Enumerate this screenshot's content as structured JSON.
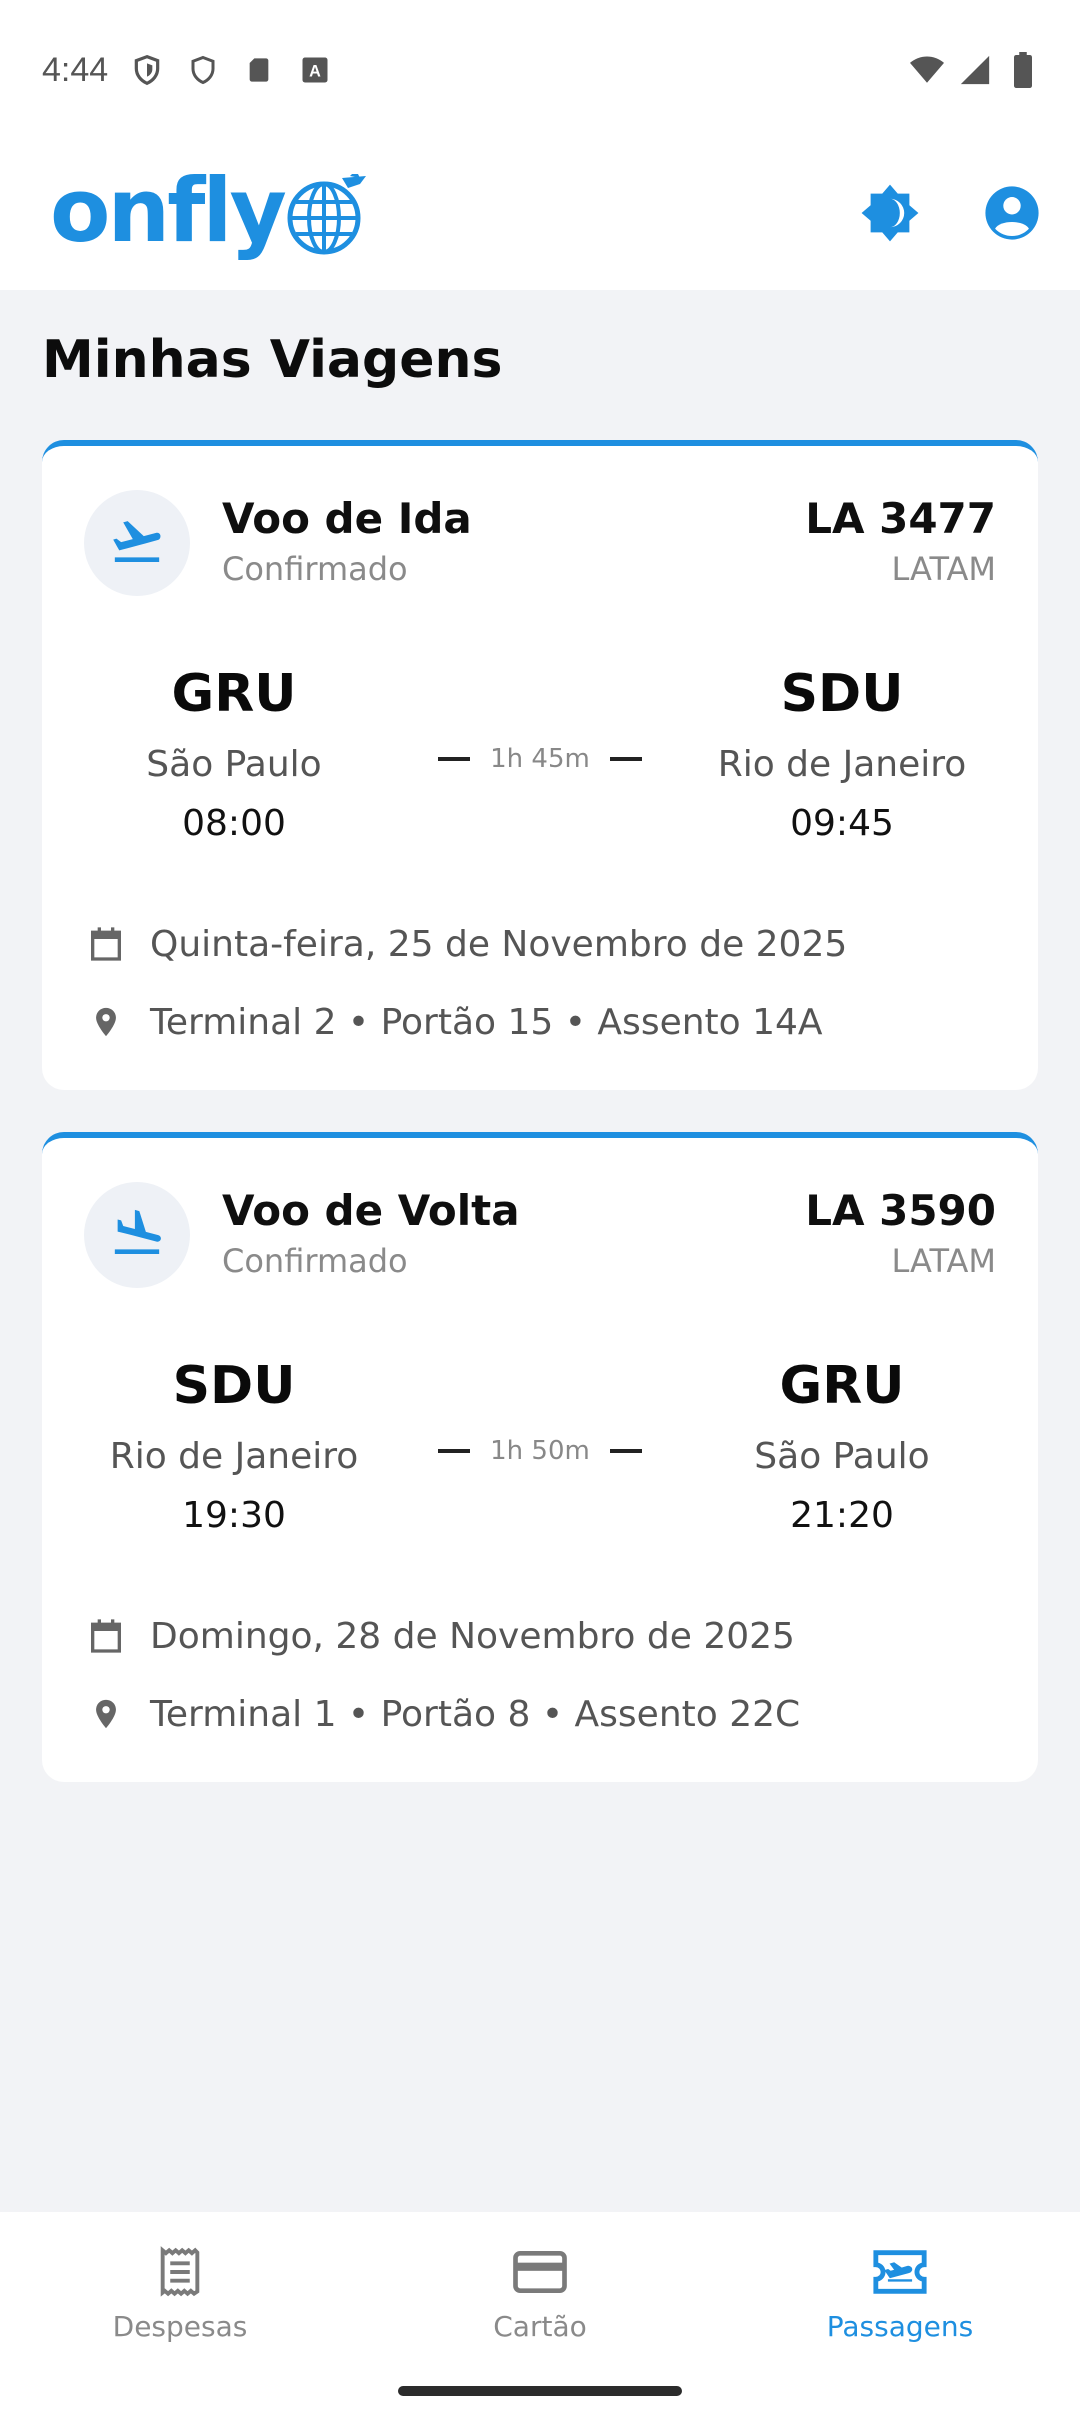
{
  "status_bar": {
    "time": "4:44",
    "icons_left": [
      "shield-icon",
      "shield-outline-icon",
      "sd-card-icon",
      "keyboard-a-icon"
    ],
    "icons_right": [
      "wifi-icon",
      "signal-icon",
      "battery-icon"
    ]
  },
  "header": {
    "logo_text": "onfly",
    "actions": [
      "brightness-icon",
      "account-circle-icon"
    ]
  },
  "page": {
    "title": "Minhas Viagens"
  },
  "flights": [
    {
      "title": "Voo de Ida",
      "status": "Confirmado",
      "number": "LA 3477",
      "airline": "LATAM",
      "icon": "flight-takeoff-icon",
      "origin": {
        "code": "GRU",
        "city": "São Paulo",
        "time": "08:00"
      },
      "destination": {
        "code": "SDU",
        "city": "Rio de Janeiro",
        "time": "09:45"
      },
      "duration": "1h 45m",
      "date": "Quinta-feira, 25 de Novembro de 2025",
      "location": "Terminal 2 • Portão 15 • Assento 14A"
    },
    {
      "title": "Voo de Volta",
      "status": "Confirmado",
      "number": "LA 3590",
      "airline": "LATAM",
      "icon": "flight-land-icon",
      "origin": {
        "code": "SDU",
        "city": "Rio de Janeiro",
        "time": "19:30"
      },
      "destination": {
        "code": "GRU",
        "city": "São Paulo",
        "time": "21:20"
      },
      "duration": "1h 50m",
      "date": "Domingo, 28 de Novembro de 2025",
      "location": "Terminal 1 • Portão 8 • Assento 22C"
    }
  ],
  "bottom_nav": {
    "items": [
      {
        "label": "Despesas",
        "icon": "receipt-icon",
        "active": false
      },
      {
        "label": "Cartão",
        "icon": "credit-card-icon",
        "active": false
      },
      {
        "label": "Passagens",
        "icon": "airplane-ticket-icon",
        "active": true
      }
    ]
  },
  "colors": {
    "accent": "#1e8fe0",
    "background": "#f2f3f6",
    "card": "#ffffff",
    "muted_text": "#8a8a8a"
  }
}
